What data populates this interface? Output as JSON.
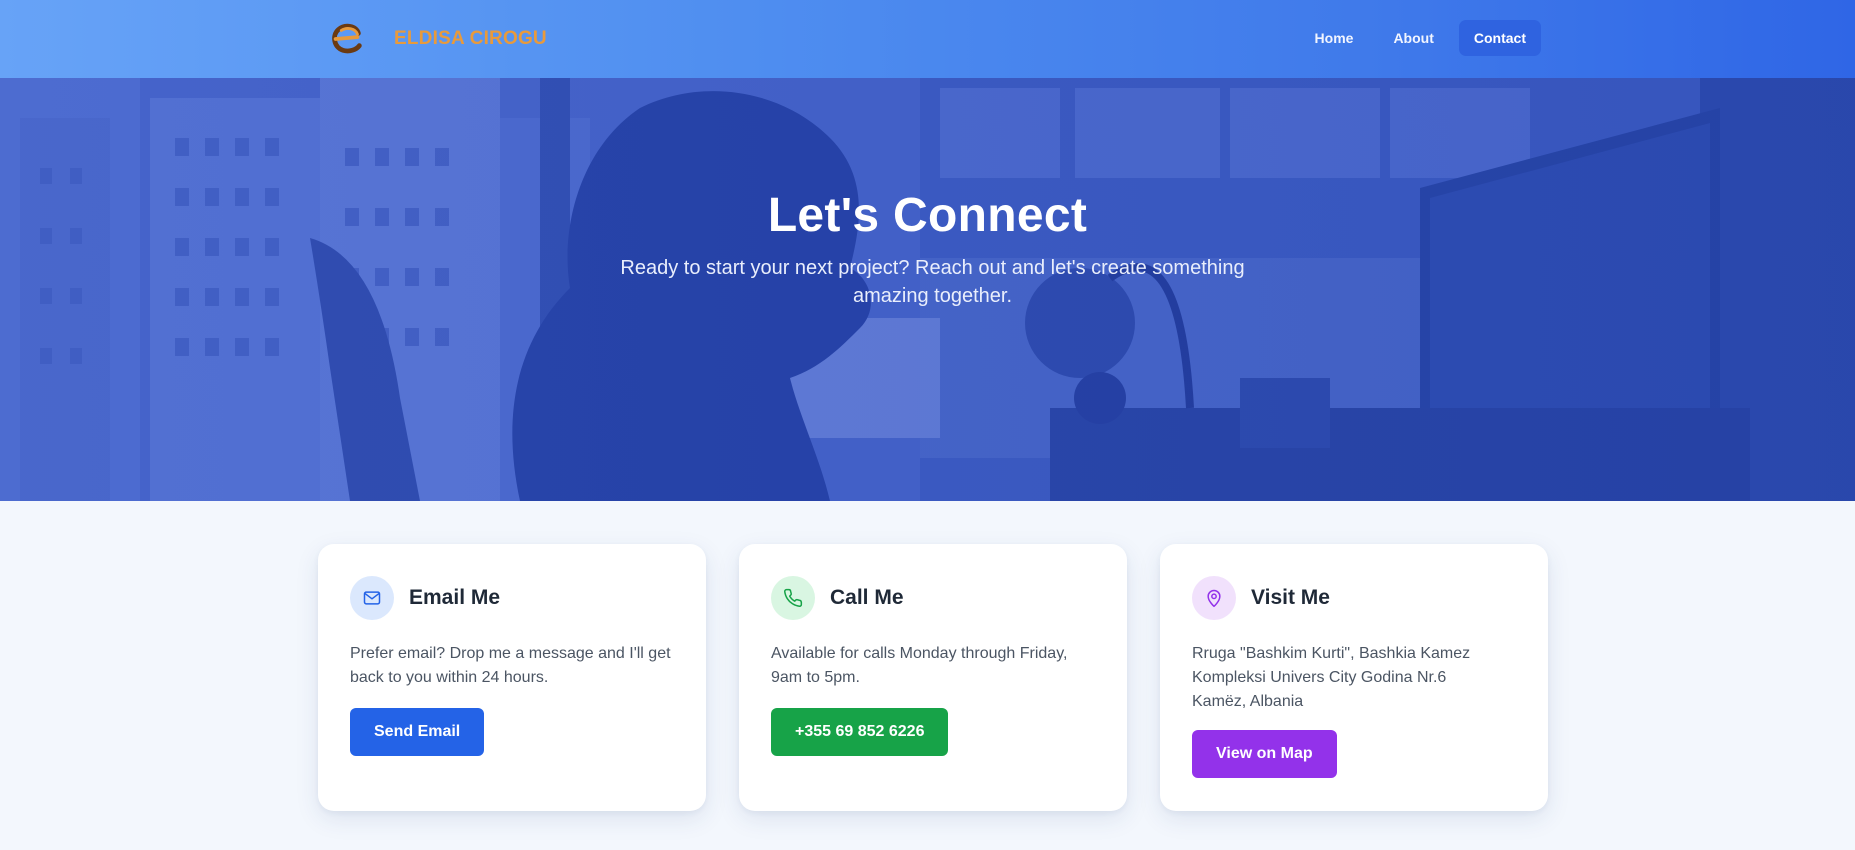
{
  "header": {
    "brand_name": "ELDISA CIROGU",
    "nav": [
      {
        "label": "Home",
        "active": false
      },
      {
        "label": "About",
        "active": false
      },
      {
        "label": "Contact",
        "active": true
      }
    ]
  },
  "hero": {
    "title": "Let's Connect",
    "subtitle": "Ready to start your next project? Reach out and let's create something amazing together."
  },
  "cards": [
    {
      "icon": "mail-icon",
      "title": "Email Me",
      "text": "Prefer email? Drop me a message and I'll get back to you within 24 hours.",
      "button": "Send Email"
    },
    {
      "icon": "phone-icon",
      "title": "Call Me",
      "text": "Available for calls Monday through Friday, 9am to 5pm.",
      "button": "+355 69 852 6226"
    },
    {
      "icon": "map-pin-icon",
      "title": "Visit Me",
      "text_lines": [
        "Rruga \"Bashkim Kurti\", Bashkia Kamez",
        "Kompleksi Univers City Godina Nr.6",
        "Kamëz, Albania"
      ],
      "button": "View on Map"
    }
  ],
  "colors": {
    "brand_orange": "#e89a3c",
    "primary_blue": "#2463e7",
    "success_green": "#17a348",
    "accent_purple": "#9332ea"
  }
}
